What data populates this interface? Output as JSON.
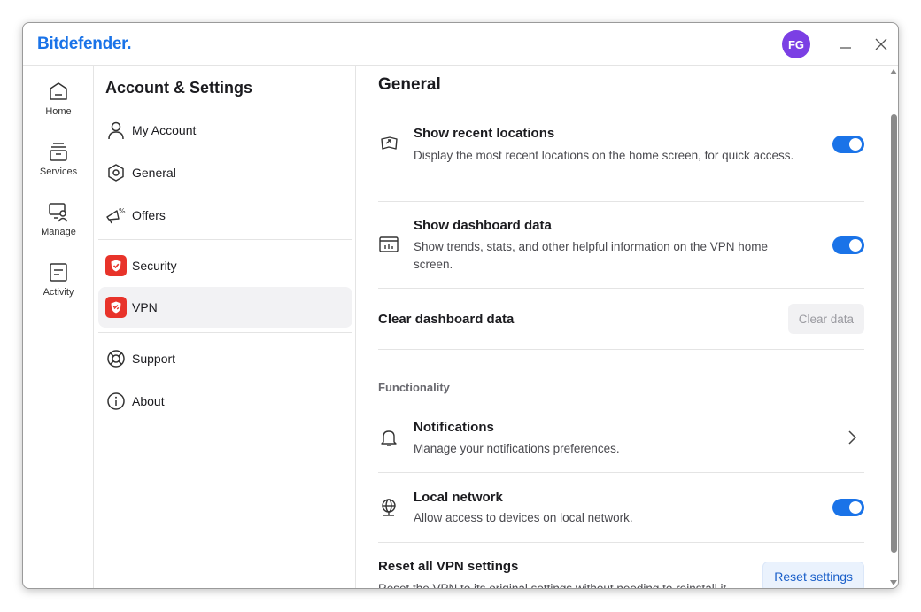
{
  "app": {
    "logo_text": "Bitdefender.",
    "avatar_initials": "FG",
    "accent": "#1a73e8",
    "avatar_color": "#7b3fe4"
  },
  "window_controls": {
    "minimize_icon": "minimize-icon",
    "close_icon": "close-icon"
  },
  "rail": {
    "items": [
      {
        "label": "Home",
        "icon": "home-icon"
      },
      {
        "label": "Services",
        "icon": "services-icon"
      },
      {
        "label": "Manage",
        "icon": "manage-icon"
      },
      {
        "label": "Activity",
        "icon": "activity-icon"
      }
    ]
  },
  "menu": {
    "title": "Account & Settings",
    "items": [
      {
        "label": "My Account",
        "icon": "user-icon"
      },
      {
        "label": "General",
        "icon": "hexagon-icon"
      },
      {
        "label": "Offers",
        "icon": "megaphone-icon"
      },
      {
        "label": "Security",
        "icon": "security-badge-icon"
      },
      {
        "label": "VPN",
        "icon": "vpn-badge-icon",
        "active": true
      },
      {
        "label": "Support",
        "icon": "lifebuoy-icon"
      },
      {
        "label": "About",
        "icon": "info-icon"
      }
    ]
  },
  "content": {
    "title": "General",
    "recent": {
      "title": "Show recent locations",
      "desc": "Display the most recent locations on the home screen, for quick access.",
      "enabled": true
    },
    "dashboard": {
      "title": "Show dashboard data",
      "desc": "Show trends, stats, and other helpful information on the VPN home screen.",
      "enabled": true
    },
    "clear": {
      "title": "Clear dashboard data",
      "button": "Clear data"
    },
    "section_functionality": "Functionality",
    "notifications": {
      "title": "Notifications",
      "desc": "Manage your notifications preferences."
    },
    "local_network": {
      "title": "Local network",
      "desc": "Allow access to devices on local network.",
      "enabled": true
    },
    "reset": {
      "title": "Reset all VPN settings",
      "desc": "Reset the VPN to its original settings without needing to reinstall it.",
      "button": "Reset settings"
    }
  }
}
